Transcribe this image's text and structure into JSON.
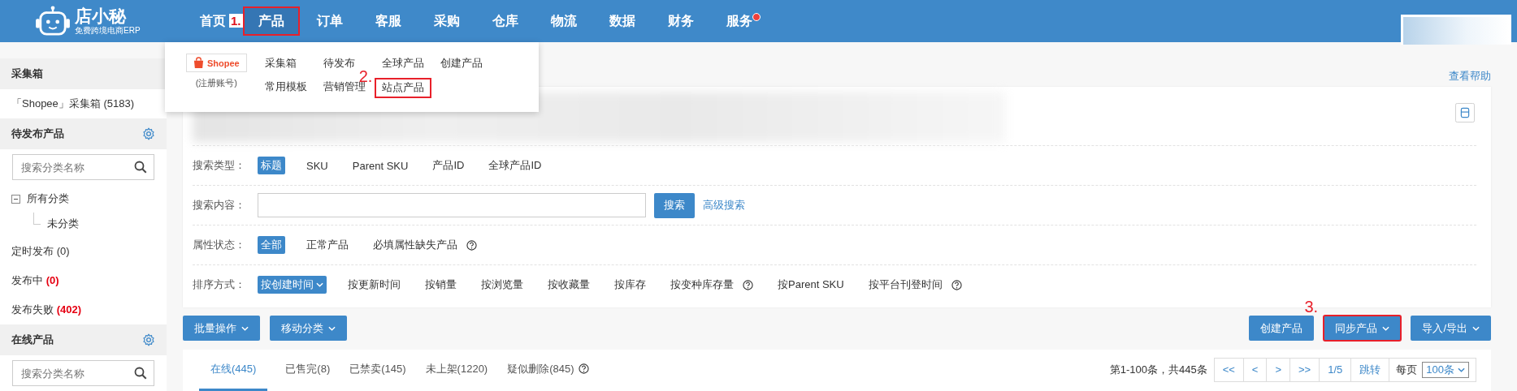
{
  "top_nav": {
    "logo_name": "店小秘",
    "logo_tagline": "免费跨境电商ERP",
    "items": [
      {
        "label": "首页",
        "selected": false,
        "badge": false
      },
      {
        "label": "产品",
        "selected": true,
        "badge": false,
        "annotation": "1."
      },
      {
        "label": "订单",
        "selected": false,
        "badge": false
      },
      {
        "label": "客服",
        "selected": false,
        "badge": false
      },
      {
        "label": "采购",
        "selected": false,
        "badge": false
      },
      {
        "label": "仓库",
        "selected": false,
        "badge": false
      },
      {
        "label": "物流",
        "selected": false,
        "badge": false
      },
      {
        "label": "数据",
        "selected": false,
        "badge": false
      },
      {
        "label": "财务",
        "selected": false,
        "badge": false
      },
      {
        "label": "服务",
        "selected": false,
        "badge": true
      }
    ]
  },
  "dropdown": {
    "platform": "Shopee",
    "platform_note": "(注册账号)",
    "rows": [
      [
        {
          "label": "采集箱"
        },
        {
          "label": "待发布"
        },
        {
          "label": "全球产品"
        },
        {
          "label": "创建产品"
        }
      ],
      [
        {
          "label": "常用模板"
        },
        {
          "label": "营销管理"
        },
        {
          "label": "站点产品",
          "annotation": "2."
        }
      ]
    ]
  },
  "sidebar": {
    "sections": [
      {
        "title": "采集箱",
        "settings": false,
        "items": [
          {
            "label": "「Shopee」采集箱",
            "count": "(5183)",
            "alert": false
          }
        ]
      },
      {
        "title": "待发布产品",
        "settings": true,
        "search_placeholder": "搜索分类名称",
        "tree": {
          "label": "所有分类",
          "expanded": true,
          "children": [
            {
              "label": "未分类"
            }
          ]
        },
        "items": [
          {
            "label": "定时发布",
            "count": "(0)",
            "alert": false
          },
          {
            "label": "发布中",
            "count": "(0)",
            "alert": true
          },
          {
            "label": "发布失败",
            "count": "(402)",
            "alert": true
          }
        ]
      },
      {
        "title": "在线产品",
        "settings": true,
        "search_placeholder": "搜索分类名称"
      }
    ]
  },
  "help_link": "查看帮助",
  "shop_row_redacted": true,
  "filters": [
    {
      "kind": "chips",
      "label": "搜索类型：",
      "options": [
        {
          "label": "标题",
          "selected": true
        },
        {
          "label": "SKU",
          "selected": false
        },
        {
          "label": "Parent SKU",
          "selected": false
        },
        {
          "label": "产品ID",
          "selected": false
        },
        {
          "label": "全球产品ID",
          "selected": false
        }
      ]
    },
    {
      "kind": "search",
      "label": "搜索内容：",
      "button": "搜索",
      "link": "高级搜索"
    },
    {
      "kind": "chips",
      "label": "属性状态：",
      "options": [
        {
          "label": "全部",
          "selected": true
        },
        {
          "label": "正常产品",
          "selected": false
        },
        {
          "label": "必填属性缺失产品",
          "selected": false,
          "help": true
        }
      ]
    },
    {
      "kind": "chips",
      "label": "排序方式：",
      "options": [
        {
          "label": "按创建时间",
          "selected": true,
          "menu": true
        },
        {
          "label": "按更新时间",
          "selected": false
        },
        {
          "label": "按销量",
          "selected": false
        },
        {
          "label": "按浏览量",
          "selected": false
        },
        {
          "label": "按收藏量",
          "selected": false
        },
        {
          "label": "按库存",
          "selected": false
        },
        {
          "label": "按变种库存量",
          "selected": false,
          "help": true
        },
        {
          "label": "按Parent SKU",
          "selected": false
        },
        {
          "label": "按平台刊登时间",
          "selected": false,
          "help": true
        }
      ]
    }
  ],
  "toolbar": {
    "left": [
      {
        "label": "批量操作",
        "menu": true
      },
      {
        "label": "移动分类",
        "menu": true
      }
    ],
    "right": [
      {
        "label": "创建产品",
        "menu": false
      },
      {
        "label": "同步产品",
        "menu": true,
        "annotation": "3."
      },
      {
        "label": "导入/导出",
        "menu": true
      }
    ]
  },
  "tabs": [
    {
      "label": "在线(445)",
      "selected": true
    },
    {
      "label": "已售完(8)",
      "selected": false
    },
    {
      "label": "已禁卖(145)",
      "selected": false
    },
    {
      "label": "未上架(1220)",
      "selected": false
    },
    {
      "label": "疑似删除(845)",
      "selected": false,
      "help": true
    }
  ],
  "pagination": {
    "summary": "第1-100条，共445条",
    "buttons": [
      "<<",
      "<",
      ">",
      ">>",
      "1/5",
      "跳转"
    ],
    "per_page_label": "每页",
    "per_page": "100条"
  }
}
